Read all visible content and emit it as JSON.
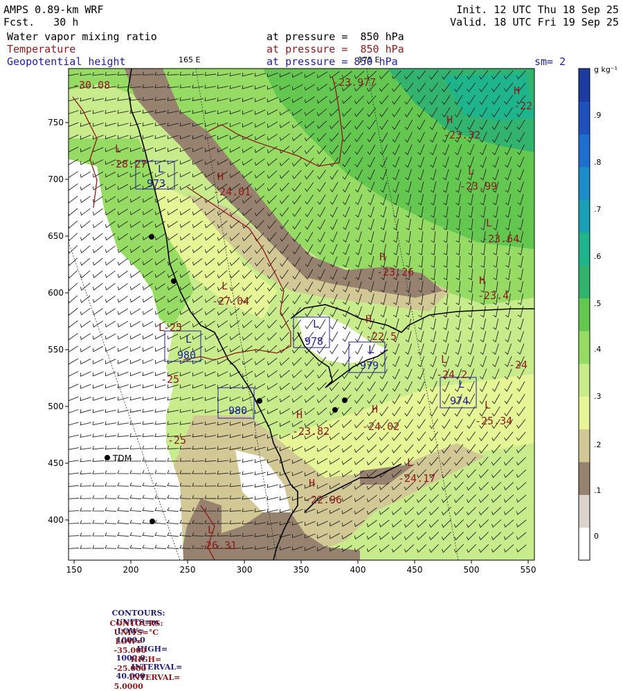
{
  "header": {
    "model": "AMPS 0.89-km WRF",
    "forecast": "Fcst.   30 h",
    "init": "Init. 12 UTC Thu 18 Sep 25",
    "valid": "Valid. 18 UTC Fri 19 Sep 25",
    "fields": [
      {
        "name": "Water vapor mixing ratio",
        "pressure": "at pressure =  850 hPa",
        "color": "#000000"
      },
      {
        "name": "Temperature",
        "pressure": "at pressure =  850 hPa",
        "color": "#8b1a1a"
      },
      {
        "name": "Geopotential height",
        "pressure": "at pressure = 850 hPa",
        "color": "#1f1f9e"
      }
    ],
    "smoothing": "sm= 2",
    "lon_165": "165 E",
    "lon_175": "175 E"
  },
  "colorbar": {
    "unit": "g kg⁻¹",
    "labels": [
      "0",
      ".1",
      ".2",
      ".3",
      ".4",
      ".5",
      ".6",
      ".7",
      ".8",
      ".9"
    ],
    "colors": [
      "#ffffff",
      "#dcd4cc",
      "#96826e",
      "#d2c896",
      "#e6f596",
      "#c8eb8c",
      "#96dc64",
      "#64c850",
      "#32b46e",
      "#1eb48c",
      "#19a0b4",
      "#1e8cc8",
      "#1e6ed2",
      "#1e50be",
      "#1e3ca0"
    ]
  },
  "axes": {
    "x_ticks": [
      "150",
      "200",
      "250",
      "300",
      "350",
      "400",
      "450",
      "500",
      "550"
    ],
    "y_ticks": [
      "750",
      "700",
      "650",
      "600",
      "550",
      "500",
      "450",
      "400"
    ]
  },
  "temperature_labels": [
    {
      "letter": "",
      "value": "-30.08"
    },
    {
      "letter": "",
      "value": "-23.977"
    },
    {
      "letter": "H",
      "value": "-22"
    },
    {
      "letter": "H",
      "value": "-23.32"
    },
    {
      "letter": "L",
      "value": "-28.27"
    },
    {
      "letter": "H",
      "value": "-24.01"
    },
    {
      "letter": "L",
      "value": "-23.99"
    },
    {
      "letter": "L",
      "value": "-23.64"
    },
    {
      "letter": "H",
      "value": "-23.26"
    },
    {
      "letter": "L",
      "value": "-27.04"
    },
    {
      "letter": "H",
      "value": "-23.4"
    },
    {
      "letter": "H",
      "value": "-22.5"
    },
    {
      "letter": "L",
      "value": "-25"
    },
    {
      "letter": "",
      "value": "-25"
    },
    {
      "letter": "L",
      "value": "-24.2"
    },
    {
      "letter": "",
      "value": "-24"
    },
    {
      "letter": "L",
      "value": "-25.34"
    },
    {
      "letter": "H",
      "value": "-24.02"
    },
    {
      "letter": "H",
      "value": "-23.82"
    },
    {
      "letter": "",
      "value": "-25"
    },
    {
      "letter": "L",
      "value": "-24.17"
    },
    {
      "letter": "H",
      "value": "-22.96"
    },
    {
      "letter": "L",
      "value": "-26.31"
    }
  ],
  "height_labels": [
    {
      "letter": "L",
      "value": "973"
    },
    {
      "letter": "L",
      "value": "980"
    },
    {
      "letter": "L",
      "value": "978"
    },
    {
      "letter": "L",
      "value": "979"
    },
    {
      "letter": "",
      "value": "980"
    },
    {
      "letter": "L",
      "value": "974"
    }
  ],
  "stations": [
    {
      "name": "TDM"
    }
  ],
  "footer": {
    "line1": [
      "CONTOURS:",
      "UNITS=m",
      "LOW=",
      "1000.0",
      "HIGH=",
      "1000.0",
      "INTERVAL=",
      "40.000"
    ],
    "line2": [
      "CONTOURS:",
      "UNITS=°C",
      "LOW=",
      "-35.000",
      "HIGH=",
      "-25.000",
      "INTERVAL=",
      "5.0000"
    ],
    "color1": "#1f1f7a",
    "color2": "#8b1a1a"
  }
}
